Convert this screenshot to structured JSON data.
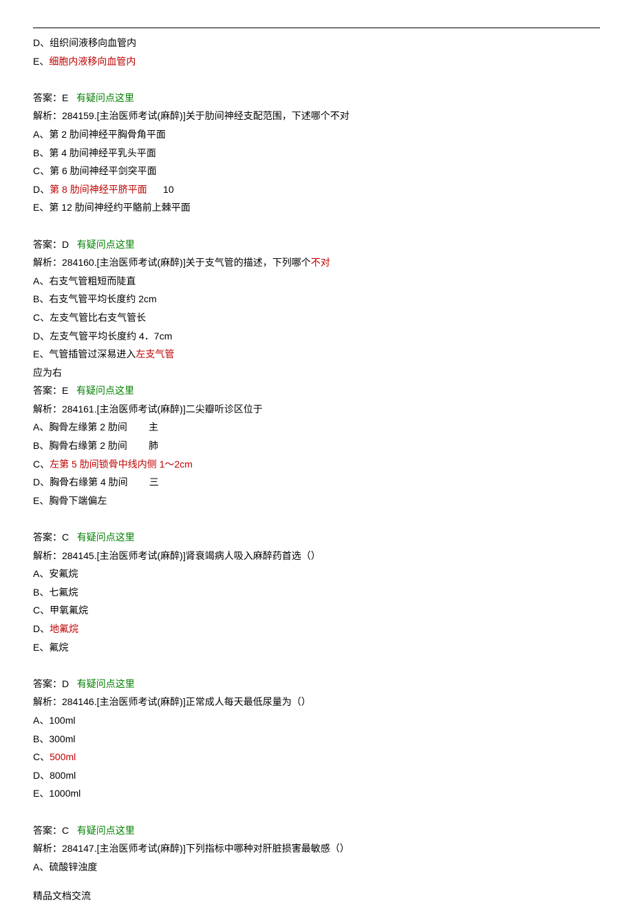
{
  "lines": [
    {
      "parts": [
        {
          "t": "D、组织间液移向血管内"
        }
      ]
    },
    {
      "parts": [
        {
          "t": "E、"
        },
        {
          "t": "细胞内液移向血管内",
          "cls": "red"
        }
      ]
    },
    {
      "blank": true
    },
    {
      "parts": [
        {
          "t": "答案：E   "
        },
        {
          "t": "有疑问点这里",
          "cls": "green"
        }
      ]
    },
    {
      "parts": [
        {
          "t": "解析：284159.[主治医师考试(麻醉)]关于肋间神经支配范围，下述哪个不对"
        }
      ]
    },
    {
      "parts": [
        {
          "t": "A、第 2 肋间神经平胸骨角平面"
        }
      ]
    },
    {
      "parts": [
        {
          "t": "B、第 4 肋间神经平乳头平面"
        }
      ]
    },
    {
      "parts": [
        {
          "t": "C、第 6 肋间神经平剑突平面"
        }
      ]
    },
    {
      "parts": [
        {
          "t": "D、"
        },
        {
          "t": "第 8 肋间神经平脐平面",
          "cls": "red"
        },
        {
          "t": "      10"
        }
      ]
    },
    {
      "parts": [
        {
          "t": "E、第 12 肋间神经约平骼前上棘平面"
        }
      ]
    },
    {
      "blank": true
    },
    {
      "parts": [
        {
          "t": "答案：D   "
        },
        {
          "t": "有疑问点这里",
          "cls": "green"
        }
      ]
    },
    {
      "parts": [
        {
          "t": "解析：284160.[主治医师考试(麻醉)]关于支气管的描述，下列哪个"
        },
        {
          "t": "不对",
          "cls": "red"
        }
      ]
    },
    {
      "parts": [
        {
          "t": "A、右支气管粗短而陡直"
        }
      ]
    },
    {
      "parts": [
        {
          "t": "B、右支气管平均长度约 2cm"
        }
      ]
    },
    {
      "parts": [
        {
          "t": "C、左支气管比右支气管长"
        }
      ]
    },
    {
      "parts": [
        {
          "t": "D、左支气管平均长度约 4．7cm"
        }
      ]
    },
    {
      "parts": [
        {
          "t": "E、气管插管过深易进入"
        },
        {
          "t": "左支气管",
          "cls": "red"
        }
      ]
    },
    {
      "parts": [
        {
          "t": "应为右"
        }
      ]
    },
    {
      "parts": [
        {
          "t": "答案：E   "
        },
        {
          "t": "有疑问点这里",
          "cls": "green"
        }
      ]
    },
    {
      "parts": [
        {
          "t": "解析：284161.[主治医师考试(麻醉)]二尖瓣听诊区位于"
        }
      ]
    },
    {
      "parts": [
        {
          "t": "A、胸骨左缘第 2 肋间        主"
        }
      ]
    },
    {
      "parts": [
        {
          "t": "B、胸骨右缘第 2 肋间        肺"
        }
      ]
    },
    {
      "parts": [
        {
          "t": "C、"
        },
        {
          "t": "左第 5 肋间锁骨中线内侧 1～2cm",
          "cls": "red"
        }
      ]
    },
    {
      "parts": [
        {
          "t": "D、胸骨右缘第 4 肋间        三"
        }
      ]
    },
    {
      "parts": [
        {
          "t": "E、胸骨下端偏左"
        }
      ]
    },
    {
      "blank": true
    },
    {
      "parts": [
        {
          "t": "答案：C   "
        },
        {
          "t": "有疑问点这里",
          "cls": "green"
        }
      ]
    },
    {
      "parts": [
        {
          "t": "解析：284145.[主治医师考试(麻醉)]肾衰竭病人吸入麻醉药首选（）"
        }
      ]
    },
    {
      "parts": [
        {
          "t": "A、安氟烷"
        }
      ]
    },
    {
      "parts": [
        {
          "t": "B、七氟烷"
        }
      ]
    },
    {
      "parts": [
        {
          "t": "C、甲氧氟烷"
        }
      ]
    },
    {
      "parts": [
        {
          "t": "D、"
        },
        {
          "t": "地氟烷",
          "cls": "red"
        }
      ]
    },
    {
      "parts": [
        {
          "t": "E、氟烷"
        }
      ]
    },
    {
      "blank": true
    },
    {
      "parts": [
        {
          "t": "答案：D   "
        },
        {
          "t": "有疑问点这里",
          "cls": "green"
        }
      ]
    },
    {
      "parts": [
        {
          "t": "解析：284146.[主治医师考试(麻醉)]正常成人每天最低尿量为（）"
        }
      ]
    },
    {
      "parts": [
        {
          "t": "A、100ml"
        }
      ]
    },
    {
      "parts": [
        {
          "t": "B、300ml"
        }
      ]
    },
    {
      "parts": [
        {
          "t": "C、"
        },
        {
          "t": "500ml",
          "cls": "red"
        }
      ]
    },
    {
      "parts": [
        {
          "t": "D、800ml"
        }
      ]
    },
    {
      "parts": [
        {
          "t": "E、1000ml"
        }
      ]
    },
    {
      "blank": true
    },
    {
      "parts": [
        {
          "t": "答案：C   "
        },
        {
          "t": "有疑问点这里",
          "cls": "green"
        }
      ]
    },
    {
      "parts": [
        {
          "t": "解析：284147.[主治医师考试(麻醉)]下列指标中哪种对肝脏损害最敏感（）"
        }
      ]
    },
    {
      "parts": [
        {
          "t": "A、硫酸锌浊度"
        }
      ]
    }
  ],
  "footer": "精品文档交流"
}
